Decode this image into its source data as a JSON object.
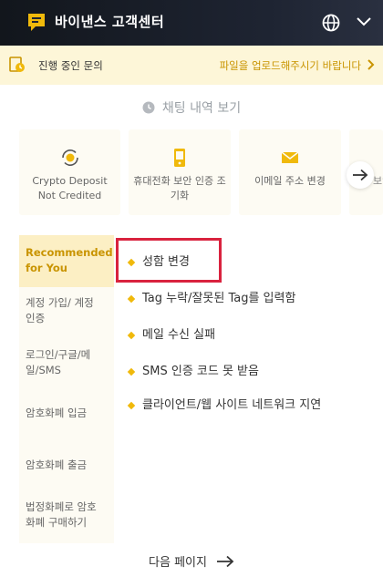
{
  "header": {
    "title": "바이낸스 고객센터",
    "globe_icon": "globe-icon",
    "menu_icon": "chevron-down-icon"
  },
  "notice": {
    "left_text": "진행 중인 문의",
    "right_text": "파일을 업로드해주시기 바랍니다"
  },
  "history": {
    "label": "채팅 내역 보기"
  },
  "quick_cards": [
    {
      "label": "Crypto Deposit Not Credited",
      "icon": "coin-refresh-icon"
    },
    {
      "label": "휴대전화 보안 인증 조기화",
      "icon": "phone-icon"
    },
    {
      "label": "이메일 주소 변경",
      "icon": "envelope-icon"
    },
    {
      "label": "보안",
      "icon": "shield-icon"
    }
  ],
  "sidebar": {
    "items": [
      {
        "label_line1": "Recommended",
        "label_line2": "for You"
      },
      {
        "label_line1": "계정 가입/ 계정",
        "label_line2": "인증"
      },
      {
        "label_line1": "로그인/구글/메",
        "label_line2": "일/SMS"
      },
      {
        "label_line1": "암호화폐 입금",
        "label_line2": ""
      },
      {
        "label_line1": "암호화폐 출금",
        "label_line2": ""
      },
      {
        "label_line1": "법정화폐로 암호",
        "label_line2": "화폐 구매하기"
      }
    ]
  },
  "questions": [
    {
      "text": "성함 변경"
    },
    {
      "text": "Tag 누락/잘못된 Tag를 입력함"
    },
    {
      "text": "메일 수신 실패"
    },
    {
      "text": "SMS 인증 코드 못 받음"
    },
    {
      "text": "클라이언트/웹 사이트 네트워크 지연"
    }
  ],
  "pagination": {
    "next_label": "다음 페이지"
  },
  "colors": {
    "accent": "#f0b90b",
    "accent_text": "#c99400",
    "highlight": "#d9223e",
    "header_bg": "#1e2432"
  }
}
